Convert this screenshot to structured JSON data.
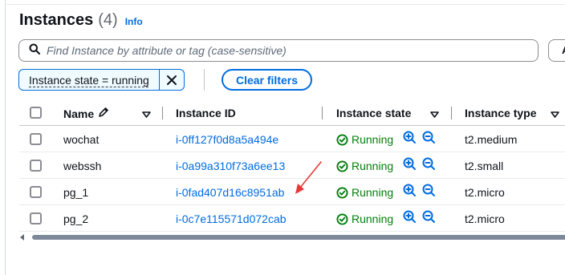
{
  "header": {
    "title": "Instances",
    "count": "(4)",
    "info": "Info"
  },
  "search": {
    "placeholder": "Find Instance by attribute or tag (case-sensitive)",
    "side_button": "A"
  },
  "filter": {
    "token": "Instance state = running",
    "clear_label": "Clear filters"
  },
  "columns": {
    "name": "Name",
    "instance_id": "Instance ID",
    "state": "Instance state",
    "type": "Instance type"
  },
  "rows": [
    {
      "name": "wochat",
      "id": "i-0ff127f0d8a5a494e",
      "state": "Running",
      "type": "t2.medium"
    },
    {
      "name": "webssh",
      "id": "i-0a99a310f73a6ee13",
      "state": "Running",
      "type": "t2.small"
    },
    {
      "name": "pg_1",
      "id": "i-0fad407d16c8951ab",
      "state": "Running",
      "type": "t2.micro"
    },
    {
      "name": "pg_2",
      "id": "i-0c7e115571d072cab",
      "state": "Running",
      "type": "t2.micro"
    }
  ],
  "colors": {
    "accent": "#006ce0",
    "success": "#037f0c",
    "annotation": "#e53935"
  }
}
